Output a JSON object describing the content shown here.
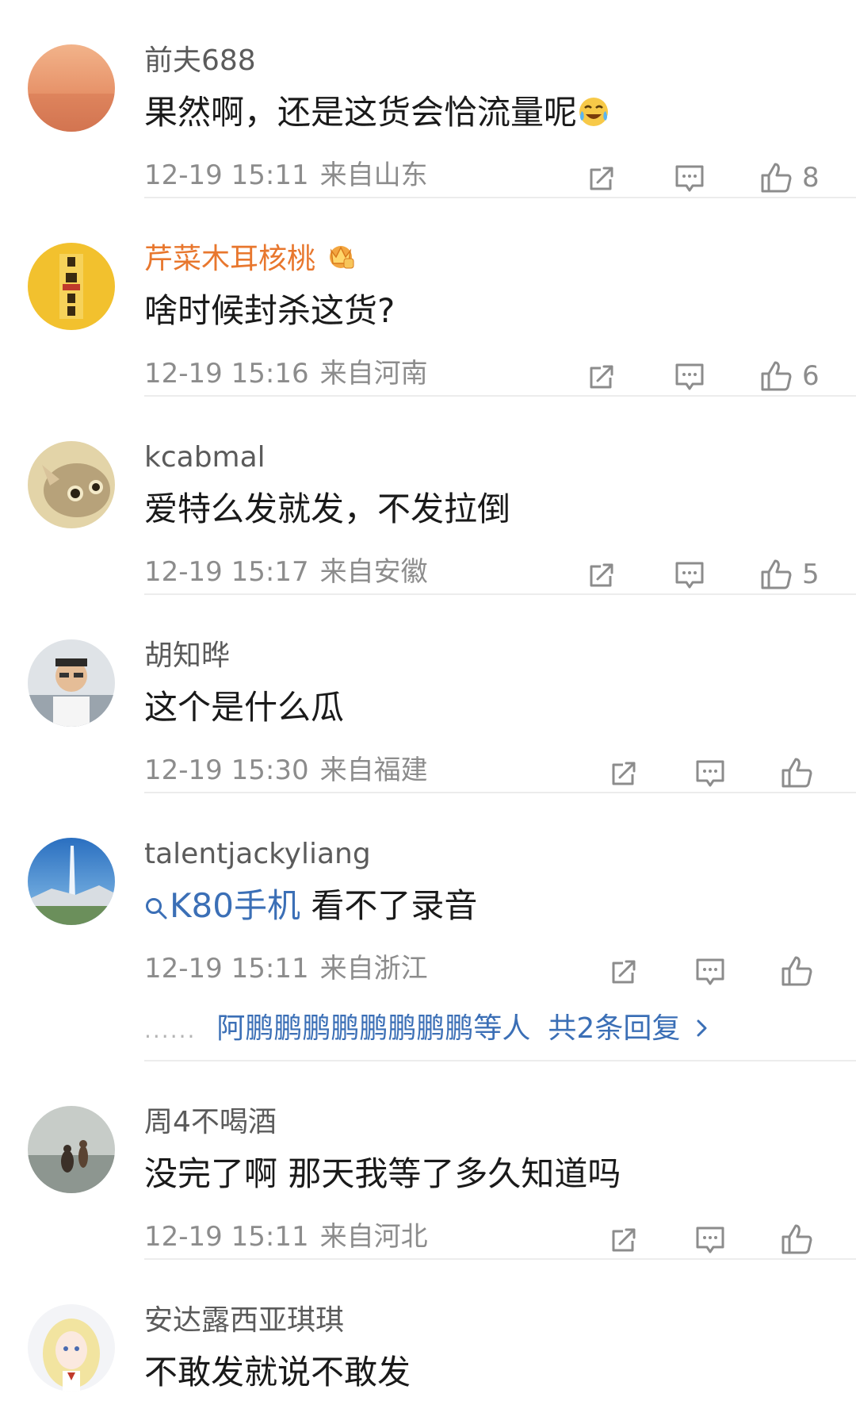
{
  "comments": [
    {
      "name": "前夫688",
      "name_style": "normal",
      "vip": false,
      "text": "果然啊，还是这货会恰流量呢",
      "emoji": "laugh-cry-emoji",
      "topic": "",
      "time": "12-19 15:11",
      "location": "来自山东",
      "likes": "8",
      "avatar": "sunset-sea",
      "replies": null
    },
    {
      "name": "芹菜木耳核桃",
      "name_style": "vip",
      "vip": true,
      "text": "啥时候封杀这货?",
      "emoji": "",
      "topic": "",
      "time": "12-19 15:16",
      "location": "来自河南",
      "likes": "6",
      "avatar": "calligraphy-seal",
      "replies": null
    },
    {
      "name": "kcabmal",
      "name_style": "normal",
      "vip": false,
      "text": "爱特么发就发，不发拉倒",
      "emoji": "",
      "topic": "",
      "time": "12-19 15:17",
      "location": "来自安徽",
      "likes": "5",
      "avatar": "cat",
      "replies": null
    },
    {
      "name": "胡知晔",
      "name_style": "normal",
      "vip": false,
      "text": "这个是什么瓜",
      "emoji": "",
      "topic": "",
      "time": "12-19 15:30",
      "location": "来自福建",
      "likes": "",
      "avatar": "man-portrait",
      "replies": null
    },
    {
      "name": "talentjackyliang",
      "name_style": "normal",
      "vip": false,
      "text": "看不了录音",
      "emoji": "",
      "topic": "K80手机",
      "time": "12-19 15:11",
      "location": "来自浙江",
      "likes": "",
      "avatar": "fountain-lake",
      "replies": {
        "users": "阿鹏鹏鹏鹏鹏鹏鹏鹏等人",
        "total": "共2条回复",
        "dots": "......"
      }
    },
    {
      "name": "周4不喝酒",
      "name_style": "normal",
      "vip": false,
      "text": "没完了啊 那天我等了多久知道吗",
      "emoji": "",
      "topic": "",
      "time": "12-19 15:11",
      "location": "来自河北",
      "likes": "",
      "avatar": "beach-people",
      "replies": null
    },
    {
      "name": "安达露西亚琪琪",
      "name_style": "normal",
      "vip": false,
      "text": "不敢发就说不敢发",
      "emoji": "",
      "topic": "",
      "time": "",
      "location": "",
      "likes": "",
      "avatar": "anime-girl",
      "replies": null
    }
  ],
  "icons": {
    "share": "share-icon",
    "comment": "comment-icon",
    "like": "like-icon",
    "topic": "search-icon",
    "vip": "vip-crown-icon",
    "chevron": "chevron-right-icon"
  },
  "colors": {
    "vip_name": "#e8772e",
    "link": "#3b6fb6",
    "meta": "#8c8c8c",
    "name": "#5b5b5b"
  }
}
